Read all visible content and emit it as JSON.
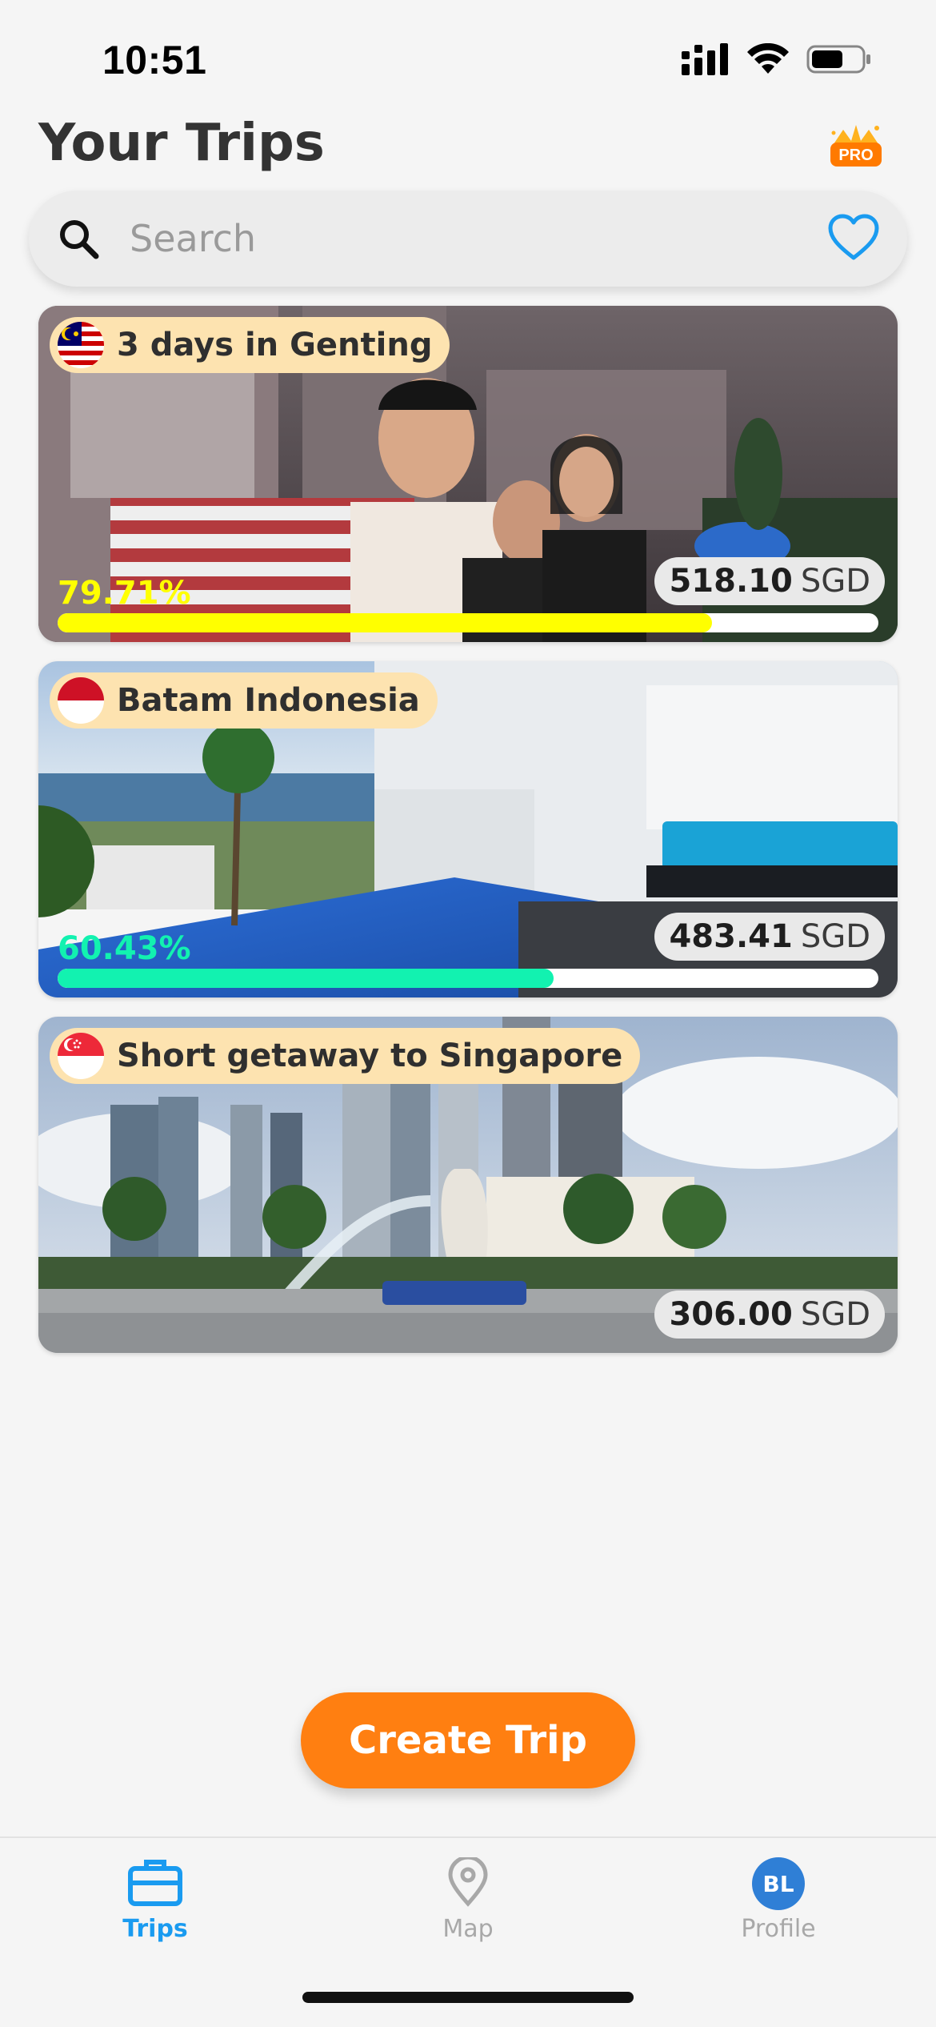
{
  "status_bar": {
    "time": "10:51"
  },
  "header": {
    "title": "Your Trips",
    "pro_badge": "PRO"
  },
  "search": {
    "placeholder": "Search",
    "value": ""
  },
  "trips": [
    {
      "title": "3 days in Genting",
      "flag": "malaysia-flag",
      "amount": "518.10",
      "currency": "SGD",
      "progress_text": "79.71%",
      "progress": 79.71,
      "progress_color": "#ffff00"
    },
    {
      "title": "Batam Indonesia",
      "flag": "indonesia-flag",
      "amount": "483.41",
      "currency": "SGD",
      "progress_text": "60.43%",
      "progress": 60.43,
      "progress_color": "#12f2b0"
    },
    {
      "title": "Short getaway to Singapore",
      "flag": "singapore-flag",
      "amount": "306.00",
      "currency": "SGD"
    }
  ],
  "create_button": {
    "label": "Create Trip"
  },
  "tabs": [
    {
      "label": "Trips",
      "icon": "briefcase-icon",
      "active": true
    },
    {
      "label": "Map",
      "icon": "map-pin-icon",
      "active": false
    },
    {
      "label": "Profile",
      "avatar_initials": "BL",
      "active": false
    }
  ],
  "colors": {
    "accent": "#ff7f11",
    "active_tab": "#1a9bf0",
    "inactive_tab": "#a8a8a8",
    "chip": "#fde3b0"
  }
}
